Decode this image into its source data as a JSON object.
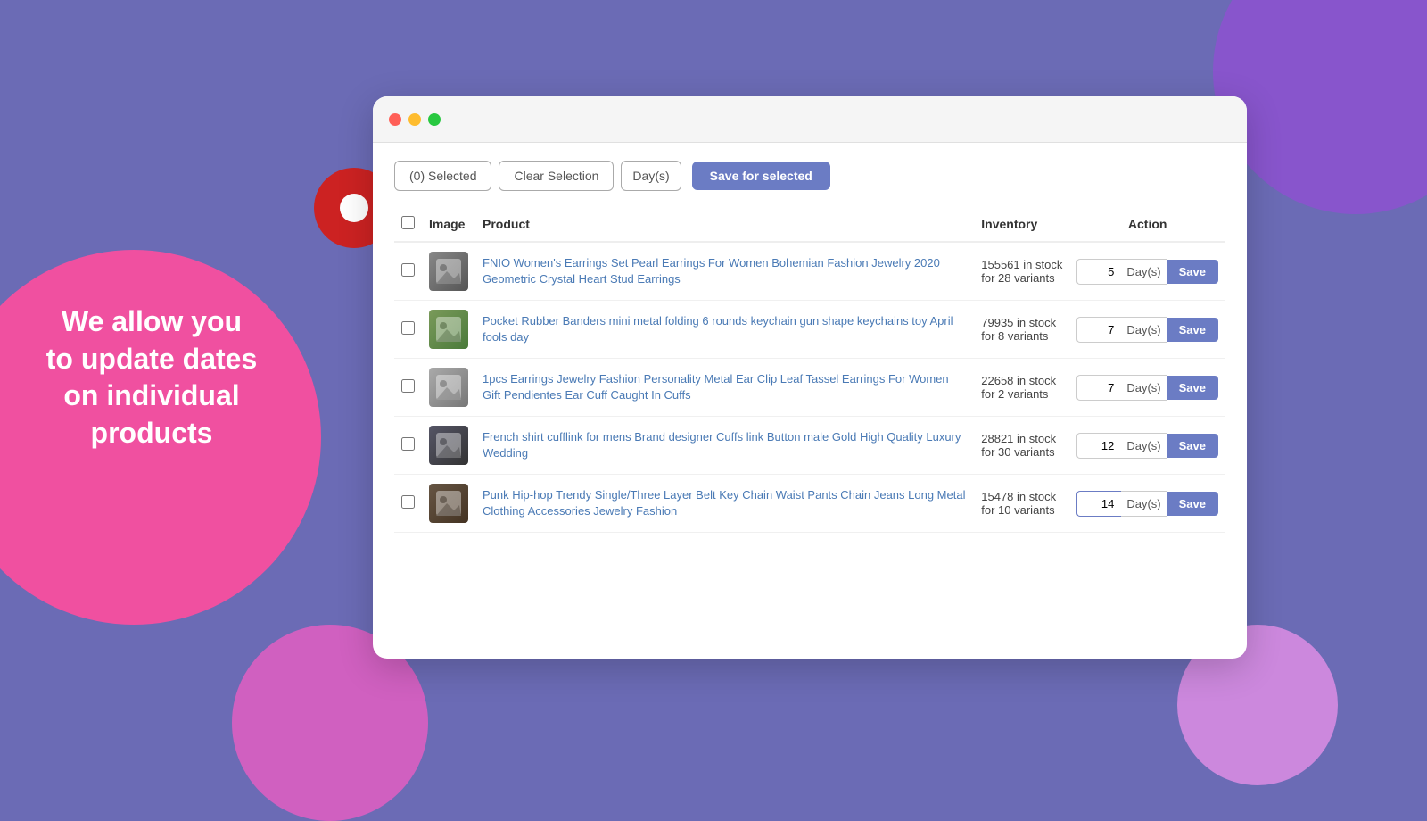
{
  "background": {
    "color": "#6b6bb5"
  },
  "left_text": {
    "line1": "We allow you",
    "line2": "to update dates",
    "line3": "on individual",
    "line4": "products"
  },
  "browser": {
    "window_buttons": [
      "red",
      "yellow",
      "green"
    ],
    "toolbar": {
      "selected_label": "(0) Selected",
      "clear_label": "Clear Selection",
      "days_label": "Day(s)",
      "save_selected_label": "Save for selected"
    },
    "table": {
      "headers": [
        "",
        "Image",
        "Product",
        "Inventory",
        "Action"
      ],
      "rows": [
        {
          "product_name": "FNIO Women's Earrings Set Pearl Earrings For Women Bohemian Fashion Jewelry 2020 Geometric Crystal Heart Stud Earrings",
          "inventory": "155561 in stock",
          "inventory_variants": "for 28 variants",
          "days_value": "5",
          "thumb_class": "thumb-1"
        },
        {
          "product_name": "Pocket Rubber Banders mini metal folding 6 rounds keychain gun shape keychains toy April fools day",
          "inventory": "79935 in stock",
          "inventory_variants": "for 8 variants",
          "days_value": "7",
          "thumb_class": "thumb-2"
        },
        {
          "product_name": "1pcs Earrings Jewelry Fashion Personality Metal Ear Clip Leaf Tassel Earrings For Women Gift Pendientes Ear Cuff Caught In Cuffs",
          "inventory": "22658 in stock",
          "inventory_variants": "for 2 variants",
          "days_value": "7",
          "thumb_class": "thumb-3"
        },
        {
          "product_name": "French shirt cufflink for mens Brand designer Cuffs link Button male Gold High Quality Luxury Wedding",
          "inventory": "28821 in stock",
          "inventory_variants": "for 30 variants",
          "days_value": "12",
          "thumb_class": "thumb-4"
        },
        {
          "product_name": "Punk Hip-hop Trendy Single/Three Layer Belt Key Chain Waist Pants Chain Jeans Long Metal Clothing Accessories Jewelry Fashion",
          "inventory": "15478 in stock",
          "inventory_variants": "for 10 variants",
          "days_value": "14",
          "thumb_class": "thumb-5",
          "focused": true
        }
      ],
      "save_button_label": "Save",
      "days_suffix": "Day(s)"
    }
  }
}
